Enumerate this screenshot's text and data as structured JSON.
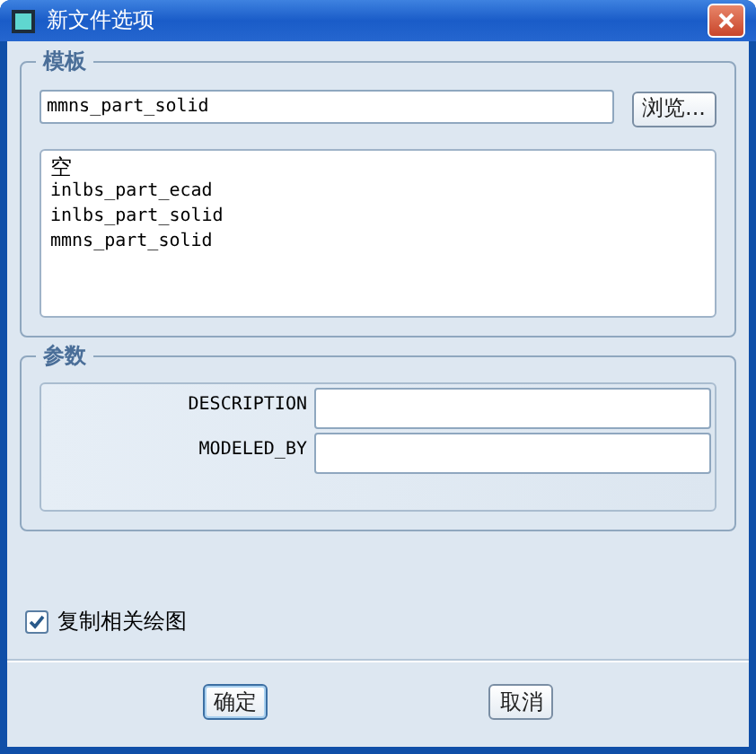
{
  "window": {
    "title": "新文件选项"
  },
  "template": {
    "legend": "模板",
    "path": {
      "value": "mmns_part_solid"
    },
    "browse_button": "浏览...",
    "items": [
      {
        "label": "空",
        "selected": false
      },
      {
        "label": "inlbs_part_ecad",
        "selected": false
      },
      {
        "label": "inlbs_part_solid",
        "selected": false
      },
      {
        "label": "mmns_part_solid",
        "selected": false
      }
    ]
  },
  "parameters": {
    "legend": "参数",
    "rows": [
      {
        "label": "DESCRIPTION"
      },
      {
        "label": "MODELED_BY"
      }
    ]
  },
  "copy_drawings": {
    "label": "复制相关绘图",
    "checked": true
  },
  "buttons": [
    {
      "label": "确定",
      "kind": "default"
    },
    {
      "label": "取消",
      "kind": "normal"
    }
  ]
}
